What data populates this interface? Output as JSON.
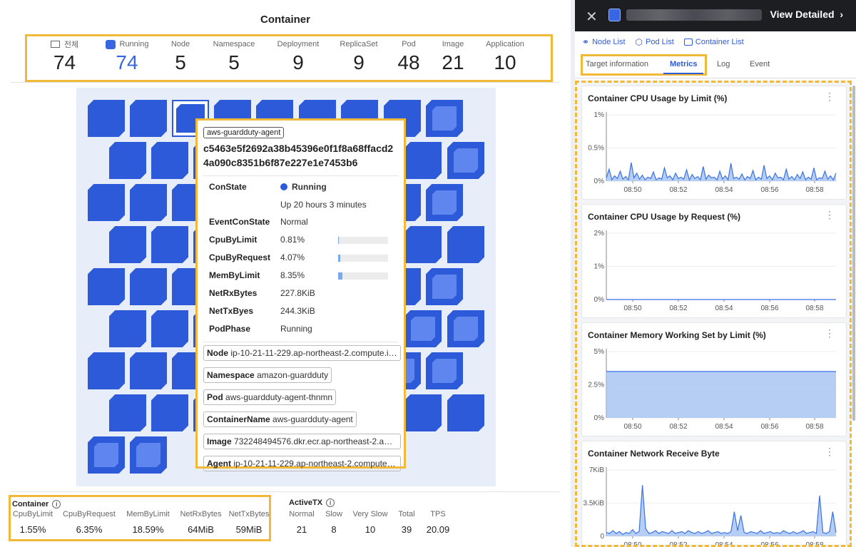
{
  "page_title": "Container",
  "summary": [
    {
      "label": "전체",
      "value": "74",
      "icon": "grid-icon"
    },
    {
      "label": "Running",
      "value": "74",
      "icon": "running-square-icon"
    },
    {
      "label": "Node",
      "value": "5"
    },
    {
      "label": "Namespace",
      "value": "5"
    },
    {
      "label": "Deployment",
      "value": "9"
    },
    {
      "label": "ReplicaSet",
      "value": "9"
    },
    {
      "label": "Pod",
      "value": "48"
    },
    {
      "label": "Image",
      "value": "21"
    },
    {
      "label": "Application",
      "value": "10"
    }
  ],
  "tooltip": {
    "tag": "aws-guardduty-agent",
    "hash": "c5463e5f2692a38b45396e0f1f8a68ffacd24a090c8351b6f87e227e1e7453b6",
    "rows": [
      {
        "key": "ConState",
        "value": "Running"
      },
      {
        "key": "",
        "value": "Up 20 hours 3 minutes"
      },
      {
        "key": "EventConState",
        "value": "Normal"
      },
      {
        "key": "CpuByLimit",
        "value": "0.81%",
        "bar": 0.0081
      },
      {
        "key": "CpuByRequest",
        "value": "4.07%",
        "bar": 0.0407
      },
      {
        "key": "MemByLimit",
        "value": "8.35%",
        "bar": 0.0835
      },
      {
        "key": "NetRxBytes",
        "value": "227.8KiB"
      },
      {
        "key": "NetTxByes",
        "value": "244.3KiB"
      },
      {
        "key": "PodPhase",
        "value": "Running"
      }
    ],
    "info": [
      {
        "k": "Node",
        "v": "ip-10-21-11-229.ap-northeast-2.compute.in..."
      },
      {
        "k": "Namespace",
        "v": "amazon-guardduty"
      },
      {
        "k": "Pod",
        "v": "aws-guardduty-agent-thnmn"
      },
      {
        "k": "ContainerName",
        "v": "aws-guardduty-agent"
      },
      {
        "k": "Image",
        "v": "732248494576.dkr.ecr.ap-northeast-2.am..."
      },
      {
        "k": "Agent",
        "v": "ip-10-21-11-229.ap-northeast-2.compute.i..."
      }
    ]
  },
  "container_metrics": {
    "title": "Container",
    "cols": [
      {
        "label": "CpuByLimit",
        "value": "1.55%"
      },
      {
        "label": "CpuByRequest",
        "value": "6.35%"
      },
      {
        "label": "MemByLimit",
        "value": "18.59%"
      },
      {
        "label": "NetRxBytes",
        "value": "64MiB"
      },
      {
        "label": "NetTxBytes",
        "value": "59MiB"
      }
    ]
  },
  "active_tx": {
    "title": "ActiveTX",
    "cols": [
      {
        "label": "Normal",
        "value": "21"
      },
      {
        "label": "Slow",
        "value": "8"
      },
      {
        "label": "Very Slow",
        "value": "10"
      },
      {
        "label": "Total",
        "value": "39"
      },
      {
        "label": "TPS",
        "value": "20.09"
      }
    ]
  },
  "right_panel": {
    "view_detailed": "View Detailed",
    "links": [
      "Node List",
      "Pod List",
      "Container List"
    ],
    "tabs": [
      "Target information",
      "Metrics",
      "Log",
      "Event"
    ],
    "active_tab": "Metrics"
  },
  "colors": {
    "accent": "#2d5ad9",
    "highlight": "#f2b938",
    "series_fill": "#a9c4f2",
    "series_line": "#3a72e8"
  },
  "chart_data": [
    {
      "type": "area",
      "title": "Container CPU Usage by Limit (%)",
      "x": [
        "08:50",
        "08:52",
        "08:54",
        "08:56",
        "08:58"
      ],
      "yticks": [
        "1%",
        "0.5%",
        "0%"
      ],
      "ylim": [
        0,
        1
      ],
      "values": [
        0.05,
        0.18,
        0.02,
        0.08,
        0.04,
        0.15,
        0.03,
        0.07,
        0.02,
        0.28,
        0.05,
        0.12,
        0.03,
        0.09,
        0.02,
        0.06,
        0.04,
        0.14,
        0.02,
        0.05,
        0.03,
        0.2,
        0.05,
        0.08,
        0.02,
        0.12,
        0.04,
        0.06,
        0.03,
        0.17,
        0.02,
        0.1,
        0.04,
        0.07,
        0.02,
        0.22,
        0.03,
        0.09,
        0.05,
        0.06,
        0.02,
        0.15,
        0.03,
        0.08,
        0.02,
        0.27,
        0.04,
        0.06,
        0.03,
        0.11,
        0.02,
        0.07,
        0.04,
        0.16,
        0.02,
        0.06,
        0.03,
        0.24,
        0.04,
        0.08,
        0.02,
        0.12,
        0.05,
        0.06,
        0.02,
        0.18,
        0.03,
        0.07,
        0.02,
        0.1,
        0.04,
        0.14,
        0.02,
        0.06,
        0.03,
        0.2,
        0.02,
        0.05,
        0.04,
        0.15,
        0.03,
        0.08,
        0.02,
        0.12
      ]
    },
    {
      "type": "line",
      "title": "Container CPU Usage by Request (%)",
      "x": [
        "08:50",
        "08:52",
        "08:54",
        "08:56",
        "08:58"
      ],
      "yticks": [
        "2%",
        "1%",
        "0%"
      ],
      "ylim": [
        0,
        2
      ],
      "values": [
        0,
        0,
        0,
        0,
        0,
        0,
        0,
        0,
        0,
        0
      ]
    },
    {
      "type": "area",
      "title": "Container Memory Working Set by Limit (%)",
      "x": [
        "08:50",
        "08:52",
        "08:54",
        "08:56",
        "08:58"
      ],
      "yticks": [
        "5%",
        "2.5%",
        "0%"
      ],
      "ylim": [
        0,
        5
      ],
      "values": [
        3.5,
        3.5,
        3.5,
        3.5,
        3.5,
        3.5,
        3.5,
        3.5,
        3.5,
        3.5
      ]
    },
    {
      "type": "area",
      "title": "Container Network Receive Byte",
      "x": [
        "08:50",
        "08:52",
        "08:54",
        "08:56",
        "08:58"
      ],
      "yticks": [
        "7KiB",
        "3.5KiB",
        "0"
      ],
      "ylim": [
        0,
        7
      ],
      "values": [
        0.4,
        0.3,
        0.6,
        0.3,
        0.5,
        0.2,
        0.4,
        0.3,
        0.7,
        0.3,
        0.5,
        5.4,
        0.8,
        0.3,
        0.4,
        0.6,
        0.3,
        0.5,
        0.4,
        0.3,
        0.6,
        0.3,
        0.4,
        0.5,
        0.3,
        0.6,
        0.4,
        0.3,
        0.5,
        0.3,
        0.4,
        0.6,
        0.3,
        0.4,
        0.5,
        0.3,
        0.4,
        0.3,
        0.5,
        2.6,
        0.6,
        2.2,
        0.4,
        0.3,
        0.5,
        0.4,
        0.3,
        0.6,
        0.3,
        0.4,
        0.5,
        0.3,
        0.4,
        0.3,
        0.6,
        0.4,
        0.3,
        0.5,
        0.3,
        0.4,
        0.6,
        0.3,
        0.4,
        0.5,
        0.3,
        4.3,
        0.4,
        0.3,
        0.5,
        2.6,
        0.4
      ]
    }
  ]
}
